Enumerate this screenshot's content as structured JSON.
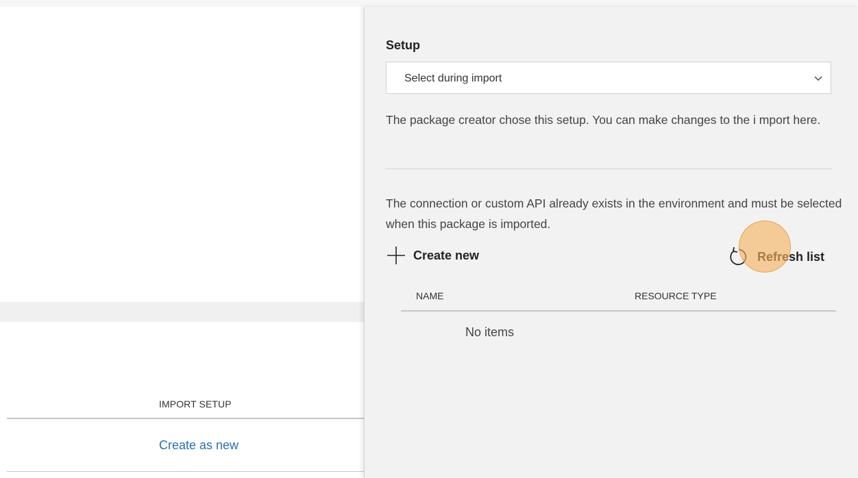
{
  "left_page": {
    "column_header": "IMPORT SETUP",
    "row_link": "Create as new"
  },
  "panel": {
    "setup_label": "Setup",
    "setup_select": {
      "selected": "Select during import"
    },
    "description": "The package creator chose this setup. You can make changes to the i mport here.",
    "info": "The connection or custom API already exists in the environment and must be selected when this package is imported.",
    "create_new_label": "Create new",
    "refresh_label": "Refresh list",
    "table": {
      "columns": [
        "NAME",
        "RESOURCE TYPE"
      ],
      "empty_message": "No items"
    }
  },
  "icons": {
    "plus": "plus-icon",
    "refresh": "refresh-icon",
    "chevron": "chevron-down-icon"
  },
  "colors": {
    "link": "#2a6fb3",
    "panel_bg": "#f2f2f2",
    "cursor_highlight": "#f6b25d"
  }
}
